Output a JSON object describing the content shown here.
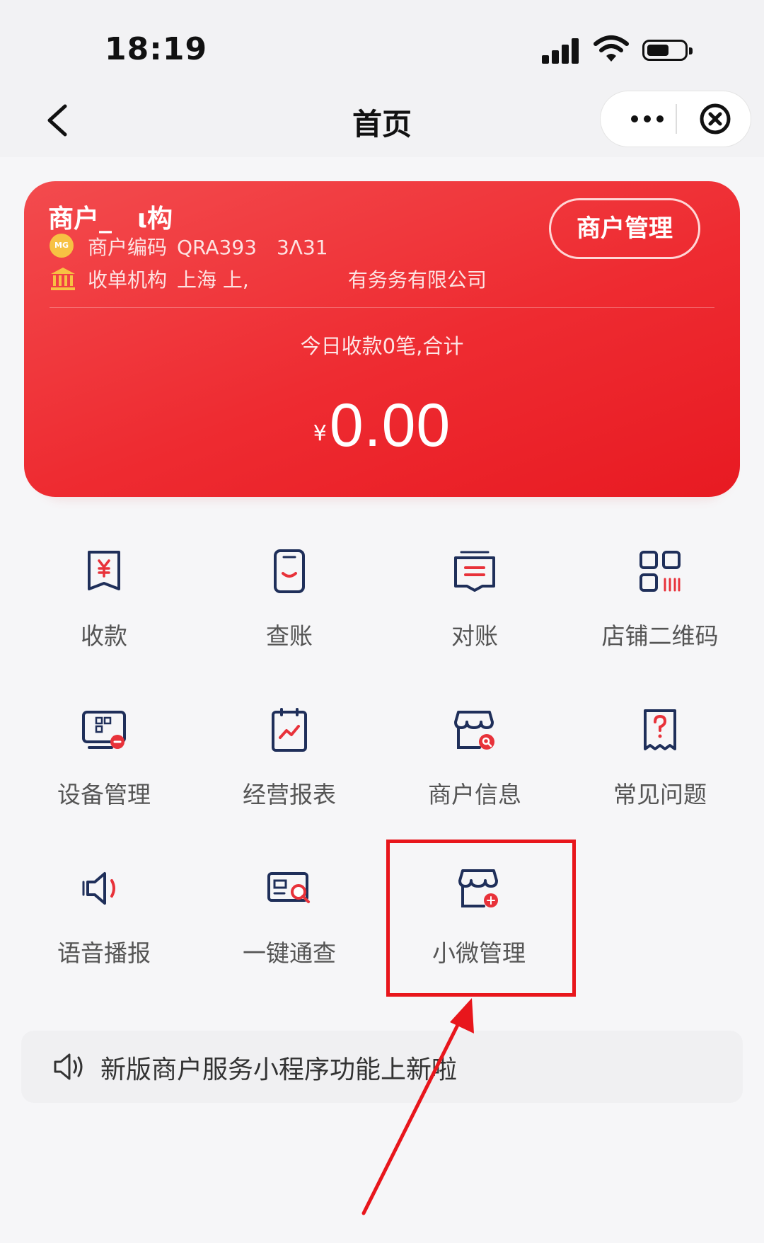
{
  "status_bar": {
    "time": "18:19"
  },
  "nav": {
    "title": "首页"
  },
  "merchant_card": {
    "name": "商户_　ι构",
    "code_label": "商户编码",
    "code_value": "QRA393　3Λ31",
    "acquirer_label": "收单机构",
    "acquirer_value": "上海 上,　　　　　有务务有限公司",
    "manage_button": "商户管理",
    "today_text": "今日收款0笔,合计",
    "currency": "¥",
    "amount": "0.00"
  },
  "grid": [
    {
      "label": "收款",
      "icon": "receipt-yen-icon"
    },
    {
      "label": "查账",
      "icon": "phone-bill-icon"
    },
    {
      "label": "对账",
      "icon": "statement-icon"
    },
    {
      "label": "店铺二维码",
      "icon": "qr-code-icon"
    },
    {
      "label": "设备管理",
      "icon": "device-icon"
    },
    {
      "label": "经营报表",
      "icon": "report-chart-icon"
    },
    {
      "label": "商户信息",
      "icon": "store-search-icon"
    },
    {
      "label": "常见问题",
      "icon": "question-icon"
    },
    {
      "label": "语音播报",
      "icon": "speaker-icon"
    },
    {
      "label": "一键通查",
      "icon": "card-search-icon"
    },
    {
      "label": "小微管理",
      "icon": "store-micro-icon"
    }
  ],
  "notice": {
    "text": "新版商户服务小程序功能上新啦"
  },
  "colors": {
    "brand_red": "#ee2b31",
    "icon_navy": "#1f2f5a",
    "icon_red": "#e8323a",
    "highlight": "#e8161c"
  }
}
